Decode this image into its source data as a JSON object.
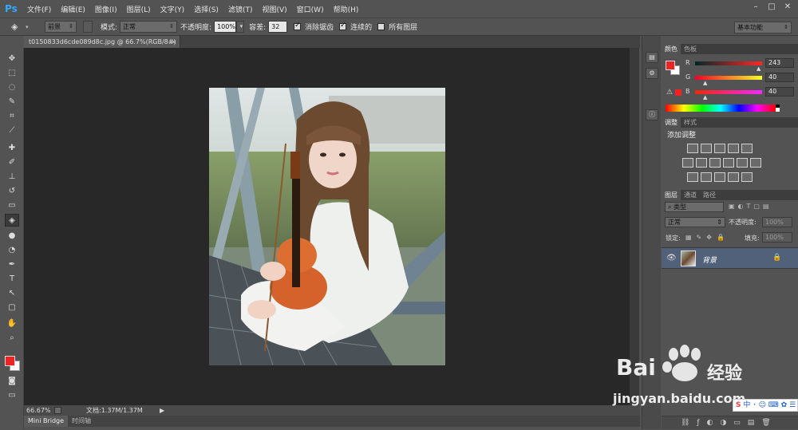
{
  "app": {
    "logo": "Ps",
    "menu": [
      "文件(F)",
      "编辑(E)",
      "图像(I)",
      "图层(L)",
      "文字(Y)",
      "选择(S)",
      "滤镜(T)",
      "视图(V)",
      "窗口(W)",
      "帮助(H)"
    ],
    "window_controls": [
      "–",
      "□",
      "✕"
    ]
  },
  "options_bar": {
    "preset": "前景",
    "mode_label": "模式:",
    "mode_value": "正常",
    "opacity_label": "不透明度:",
    "opacity_value": "100%",
    "tolerance_label": "容差:",
    "tolerance_value": "32",
    "antialias_label": "消除锯齿",
    "contiguous_label": "连续的",
    "all_layers_label": "所有图层",
    "workspace": "基本功能"
  },
  "document": {
    "tab_title": "t0150833d6cde089d8c.jpg @ 66.7%(RGB/8#)",
    "close": "×"
  },
  "status_bar": {
    "zoom": "66.67%",
    "doc_info": "文档:1.37M/1.37M"
  },
  "bottom_tabs": [
    "Mini Bridge",
    "时间轴"
  ],
  "tools": [
    {
      "icon": "move-icon",
      "glyph": "✥"
    },
    {
      "icon": "marquee-icon",
      "glyph": "⬚"
    },
    {
      "icon": "lasso-icon",
      "glyph": "◌"
    },
    {
      "icon": "quick-select-icon",
      "glyph": "✎"
    },
    {
      "icon": "crop-icon",
      "glyph": "⌗"
    },
    {
      "icon": "eyedropper-icon",
      "glyph": "⟋"
    },
    {
      "icon": "healing-icon",
      "glyph": "✚"
    },
    {
      "icon": "brush-icon",
      "glyph": "✐"
    },
    {
      "icon": "stamp-icon",
      "glyph": "⊥"
    },
    {
      "icon": "history-brush-icon",
      "glyph": "↺"
    },
    {
      "icon": "eraser-icon",
      "glyph": "▭"
    },
    {
      "icon": "paint-bucket-icon",
      "glyph": "◈"
    },
    {
      "icon": "blur-icon",
      "glyph": "●"
    },
    {
      "icon": "dodge-icon",
      "glyph": "◔"
    },
    {
      "icon": "pen-icon",
      "glyph": "✒"
    },
    {
      "icon": "type-icon",
      "glyph": "T"
    },
    {
      "icon": "path-select-icon",
      "glyph": "↖"
    },
    {
      "icon": "rectangle-icon",
      "glyph": "▢"
    },
    {
      "icon": "hand-icon",
      "glyph": "✋"
    },
    {
      "icon": "zoom-icon",
      "glyph": "⌕"
    }
  ],
  "color_panel": {
    "tabs": [
      "颜色",
      "色板"
    ],
    "fg_color": "#ee2424",
    "bg_color": "#ffffff",
    "r_label": "R",
    "r_value": "243",
    "g_label": "G",
    "g_value": "40",
    "b_label": "B",
    "b_value": "40"
  },
  "adjustments_panel": {
    "tabs": [
      "调整",
      "样式"
    ],
    "title": "添加调整"
  },
  "layers_panel": {
    "tabs": [
      "图层",
      "通道",
      "路径"
    ],
    "filter": "类型",
    "blend_mode": "正常",
    "opacity_label": "不透明度:",
    "opacity_value": "100%",
    "lock_label": "锁定:",
    "fill_label": "填充:",
    "fill_value": "100%",
    "layer_name": "背景"
  },
  "watermark": {
    "brand": "Bai",
    "brand_suffix": "经验",
    "url": "jingyan.baidu.com"
  },
  "colors": {
    "ui_bg": "#535353",
    "canvas_bg": "#282828",
    "layer_selected": "#52617a"
  }
}
